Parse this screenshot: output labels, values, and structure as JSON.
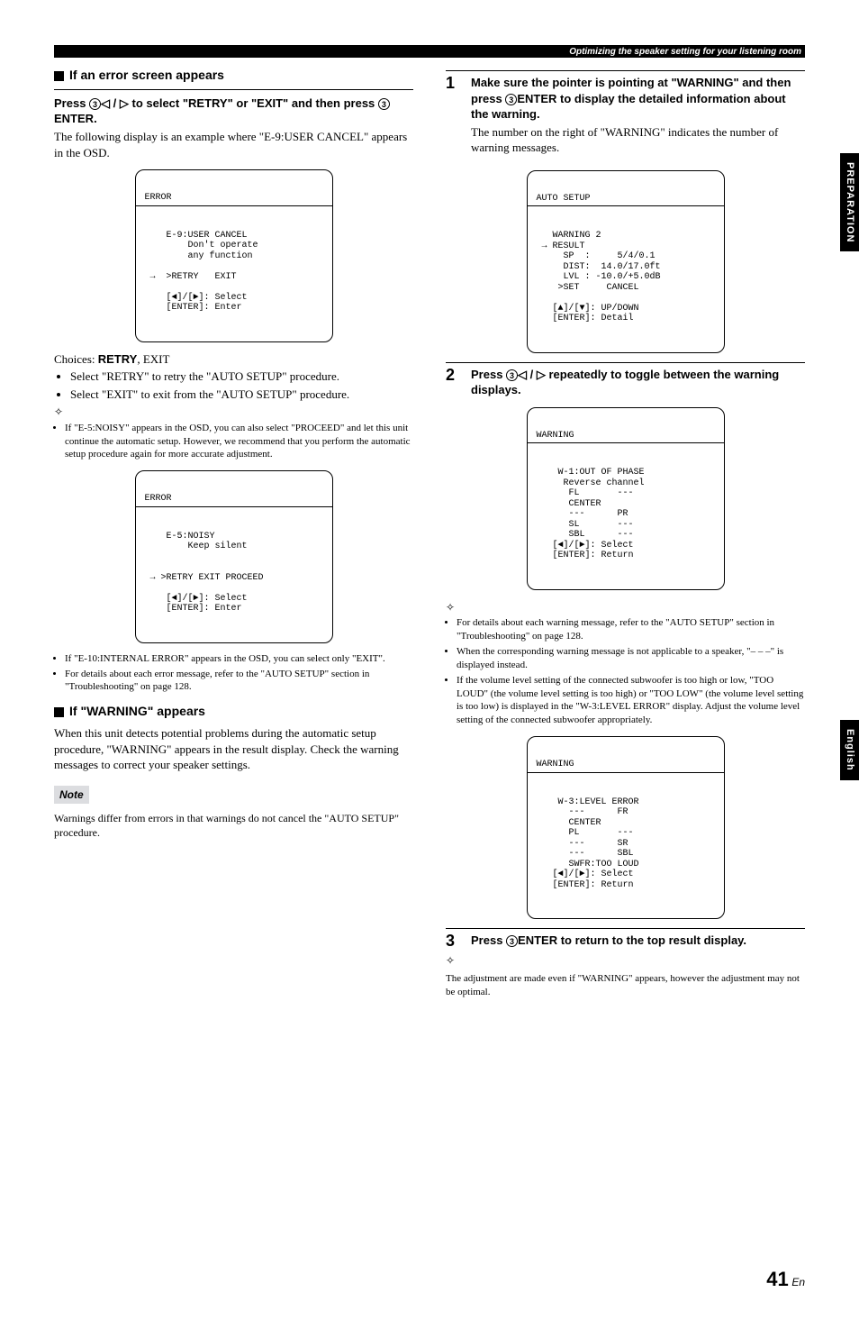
{
  "header": {
    "strip_label": "Optimizing the speaker setting for your listening room"
  },
  "left": {
    "h_error": "If an error screen appears",
    "instr1_pre": "Press ",
    "instr1_mid": " to select \"RETRY\" or \"EXIT\" and then press ",
    "instr1_end": ".",
    "btn3": "3",
    "arrows": "◁ / ▷",
    "enter": "ENTER",
    "body1": "The following display is an example where \"E-9:USER CANCEL\" appears in the OSD.",
    "osd1_title": "ERROR",
    "osd1_lines": "    E-9:USER CANCEL\n        Don't operate\n        any function\n\n →  >RETRY   EXIT\n\n    [◄]/[►]: Select\n    [ENTER]: Enter",
    "choices_label": "Choices: ",
    "choices_bold": "RETRY",
    "choices_rest": ", EXIT",
    "bullet_a": "Select \"RETRY\" to retry the \"AUTO SETUP\" procedure.",
    "bullet_b": "Select \"EXIT\" to exit from the \"AUTO SETUP\" procedure.",
    "tip1": "If \"E-5:NOISY\" appears in the OSD, you can also select \"PROCEED\" and let this unit continue the automatic setup. However, we recommend that you perform the automatic setup procedure again for more accurate adjustment.",
    "osd2_title": "ERROR",
    "osd2_lines": "    E-5:NOISY\n        Keep silent\n\n\n → >RETRY EXIT PROCEED\n\n    [◄]/[►]: Select\n    [ENTER]: Enter",
    "tip2": "If \"E-10:INTERNAL ERROR\" appears in the OSD, you can select only \"EXIT\".",
    "tip3": "For details about each error message, refer to the \"AUTO SETUP\" section in \"Troubleshooting\" on page 128.",
    "h_warn": "If \"WARNING\" appears",
    "warn_body": "When this unit detects potential problems during the automatic setup procedure, \"WARNING\" appears in the result display. Check the warning messages to correct your speaker settings.",
    "note_label": "Note",
    "note_body": "Warnings differ from errors in that warnings do not cancel the \"AUTO SETUP\" procedure."
  },
  "right": {
    "step1_head_a": "Make sure the pointer is pointing at \"WARNING\" and then press ",
    "step1_head_b": " to display the detailed information about the warning.",
    "step1_body": "The number on the right of \"WARNING\" indicates the number of warning messages.",
    "osd3_title": "AUTO SETUP",
    "osd3_lines": "   WARNING 2\n → RESULT\n     SP  :     5/4/0.1\n     DIST:  14.0/17.0ft\n     LVL : -10.0/+5.0dB\n    >SET     CANCEL\n\n   [▲]/[▼]: UP/DOWN\n   [ENTER]: Detail",
    "step2_head_a": "Press ",
    "step2_head_b": " repeatedly to toggle between the warning displays.",
    "osd4_title": "WARNING",
    "osd4_lines": "    W-1:OUT OF PHASE\n     Reverse channel\n      FL       ---\n      CENTER\n      ---      PR\n      SL       ---\n      SBL      ---\n   [◄]/[►]: Select\n   [ENTER]: Return",
    "tip_r1": "For details about each warning message, refer to the \"AUTO SETUP\" section in \"Troubleshooting\" on page 128.",
    "tip_r2": "When the corresponding warning message is not applicable to a speaker, \"– – –\" is displayed instead.",
    "tip_r3": "If the volume level setting of the connected subwoofer is too high or low, \"TOO LOUD\" (the volume level setting is too high) or \"TOO LOW\" (the volume level setting is too low) is displayed in the \"W-3:LEVEL ERROR\" display. Adjust the volume level setting of the connected subwoofer appropriately.",
    "osd5_title": "WARNING",
    "osd5_lines": "    W-3:LEVEL ERROR\n      ---      FR\n      CENTER\n      PL       ---\n      ---      SR\n      ---      SBL\n      SWFR:TOO LOUD\n   [◄]/[►]: Select\n   [ENTER]: Return",
    "step3_head_a": "Press ",
    "step3_head_b": " to return to the top result display.",
    "tip_r4": "The adjustment are made even if \"WARNING\" appears, however the adjustment may not be optimal."
  },
  "tabs": {
    "prep": "PREPARATION",
    "lang": "English"
  },
  "page": {
    "num": "41",
    "suffix": "En"
  }
}
